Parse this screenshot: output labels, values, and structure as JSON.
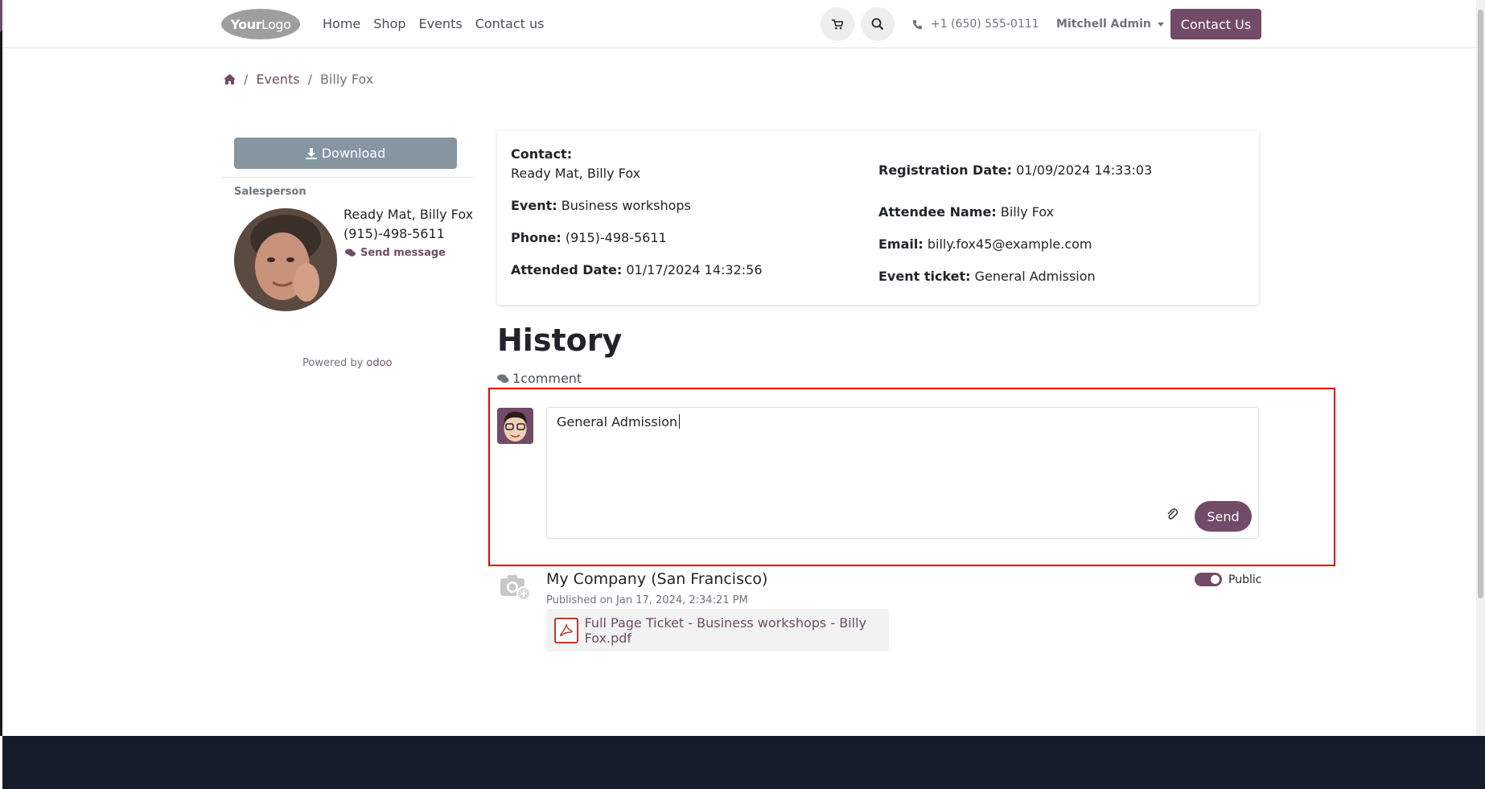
{
  "header": {
    "logo_text": "YourLogo",
    "nav": [
      "Home",
      "Shop",
      "Events",
      "Contact us"
    ],
    "phone": "+1 (650) 555-0111",
    "user": "Mitchell Admin",
    "contact_button": "Contact Us"
  },
  "breadcrumb": {
    "events": "Events",
    "current": "Billy Fox"
  },
  "sidebar": {
    "download": "Download",
    "salesperson_label": "Salesperson",
    "name": "Ready Mat, Billy Fox",
    "phone": "(915)-498-5611",
    "send_message": "Send message",
    "powered_by": "Powered by",
    "odoo": "odoo"
  },
  "details": {
    "contact_label": "Contact:",
    "contact_value": "Ready Mat, Billy Fox",
    "event_label": "Event:",
    "event_value": "Business workshops",
    "phone_label": "Phone:",
    "phone_value": "(915)-498-5611",
    "attended_label": "Attended Date:",
    "attended_value": "01/17/2024 14:32:56",
    "registration_label": "Registration Date:",
    "registration_value": "01/09/2024 14:33:03",
    "attendee_label": "Attendee Name:",
    "attendee_value": "Billy Fox",
    "email_label": "Email:",
    "email_value": "billy.fox45@example.com",
    "ticket_label": "Event ticket:",
    "ticket_value": "General Admission"
  },
  "history": {
    "title": "History",
    "comment_count": "1comment",
    "composer_text": "General Admission",
    "send": "Send",
    "message": {
      "author": "My Company (San Francisco)",
      "date": "Published on Jan 17, 2024, 2:34:21 PM",
      "public_label": "Public",
      "attachment": "Full Page Ticket - Business workshops - Billy Fox.pdf"
    }
  },
  "colors": {
    "primary": "#714b67",
    "download": "#8595a2",
    "footer": "#161b2c",
    "highlight": "#e60000"
  }
}
